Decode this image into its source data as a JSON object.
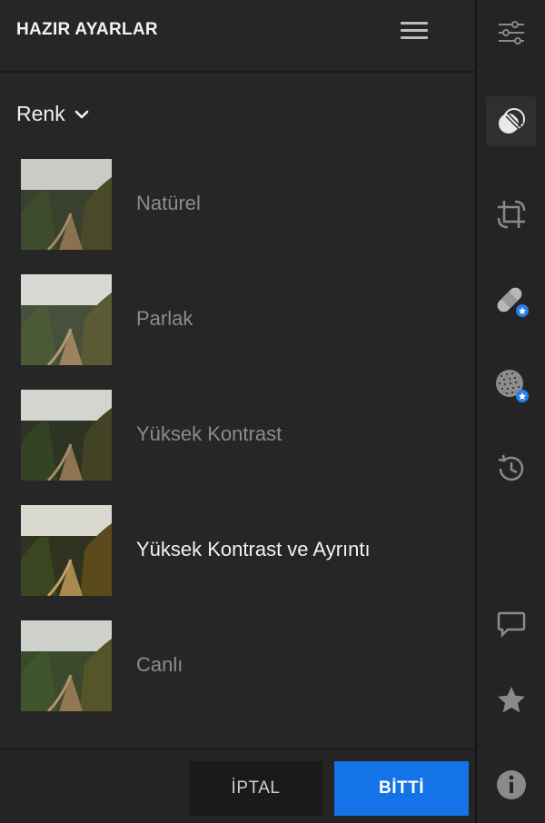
{
  "header": {
    "title": "HAZIR AYARLAR",
    "menu_icon": "hamburger-icon"
  },
  "category": {
    "label": "Renk",
    "icon": "chevron-down-icon"
  },
  "presets": [
    {
      "name": "Natürel",
      "selected": false
    },
    {
      "name": "Parlak",
      "selected": false
    },
    {
      "name": "Yüksek Kontrast",
      "selected": false
    },
    {
      "name": "Yüksek Kontrast ve Ayrıntı",
      "selected": true
    },
    {
      "name": "Canlı",
      "selected": false
    }
  ],
  "footer": {
    "cancel_label": "İPTAL",
    "done_label": "BİTTİ"
  },
  "rail": [
    {
      "icon": "sliders-icon",
      "active": false
    },
    {
      "icon": "presets-icon",
      "active": true
    },
    {
      "icon": "crop-icon",
      "active": false
    },
    {
      "icon": "healing-bandage-icon",
      "active": false,
      "premium": true
    },
    {
      "icon": "selective-mask-icon",
      "active": false,
      "premium": true
    },
    {
      "icon": "history-icon",
      "active": false
    },
    {
      "icon": "comment-icon",
      "active": false
    },
    {
      "icon": "star-icon",
      "active": false
    },
    {
      "icon": "info-icon",
      "active": false
    }
  ],
  "colors": {
    "accent": "#1473e6",
    "panel": "#262626",
    "text_muted": "#8c8c8c",
    "text_active": "#f2f2f2"
  }
}
